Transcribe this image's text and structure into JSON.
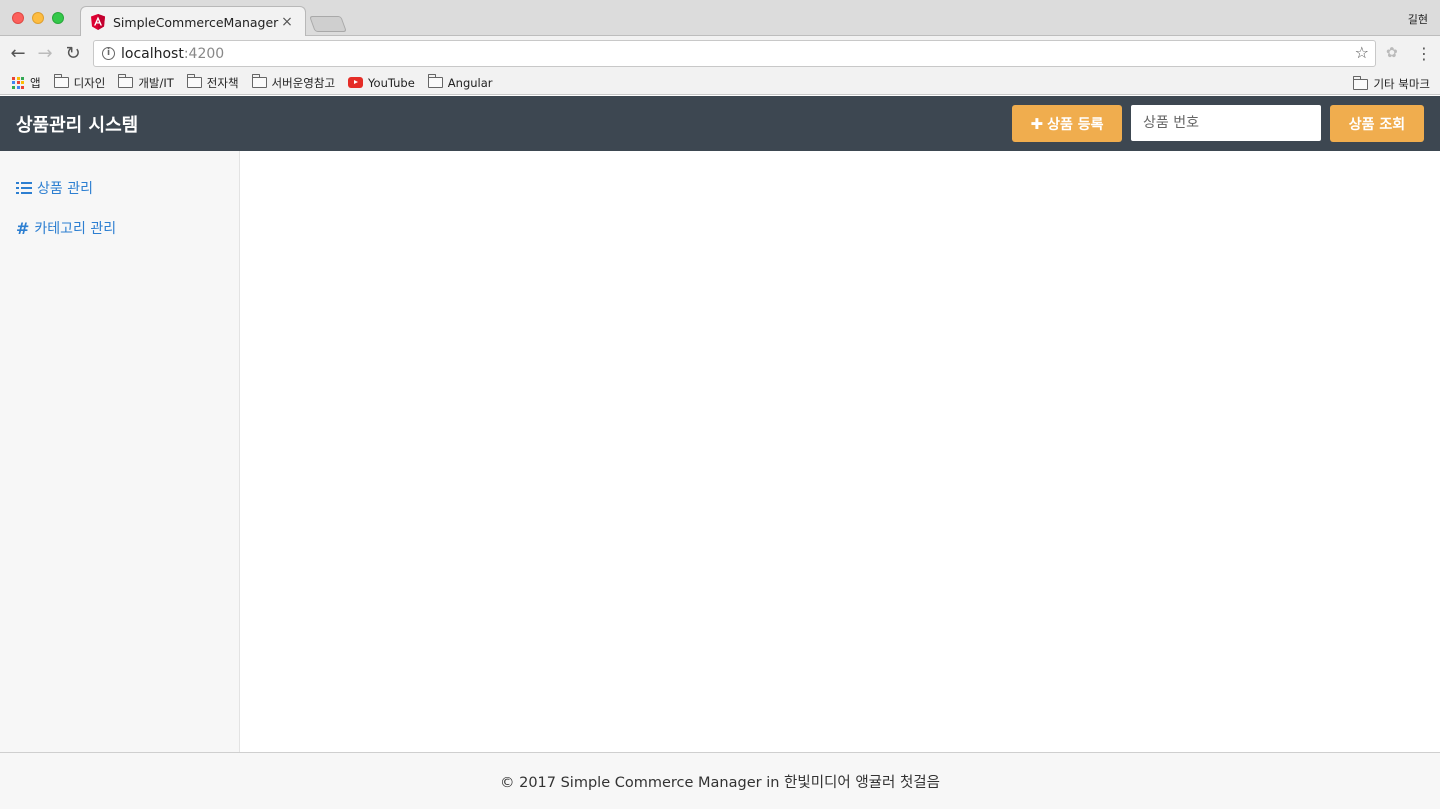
{
  "browser": {
    "tab_title": "SimpleCommerceManager",
    "tab_close": "×",
    "profile_name": "길현",
    "url_host": "localhost",
    "url_port": ":4200",
    "bookmarks": [
      "앱",
      "디자인",
      "개발/IT",
      "전자책",
      "서버운영참고",
      "YouTube",
      "Angular"
    ],
    "other_bookmarks": "기타 북마크"
  },
  "header": {
    "brand": "상품관리 시스템",
    "register_label": "상품 등록",
    "search_placeholder": "상품 번호",
    "lookup_label": "상품 조회",
    "accent_color": "#f0ad4e",
    "bg_color": "#3d4751"
  },
  "sidebar": {
    "items": [
      {
        "label": "상품 관리",
        "icon": "list-icon"
      },
      {
        "label": "카테고리 관리",
        "icon": "hashtag-icon"
      }
    ],
    "link_color": "#2d7fd1"
  },
  "footer": {
    "text": "© 2017 Simple Commerce Manager in 한빛미디어 앵귤러 첫걸음"
  }
}
